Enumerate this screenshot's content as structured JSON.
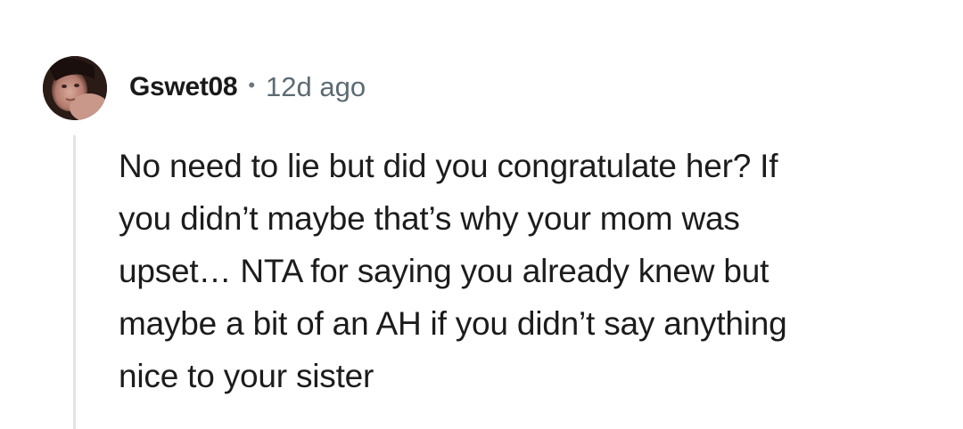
{
  "comment": {
    "author": "Gswet08",
    "separator": "•",
    "timestamp": "12d ago",
    "body_lines": [
      "No need to lie but did you congratulate her? If",
      "you didn’t maybe that’s why your mom was",
      "upset… NTA for saying you already knew but",
      "maybe a bit of an AH if you didn’t say anything",
      "nice to your sister"
    ]
  }
}
